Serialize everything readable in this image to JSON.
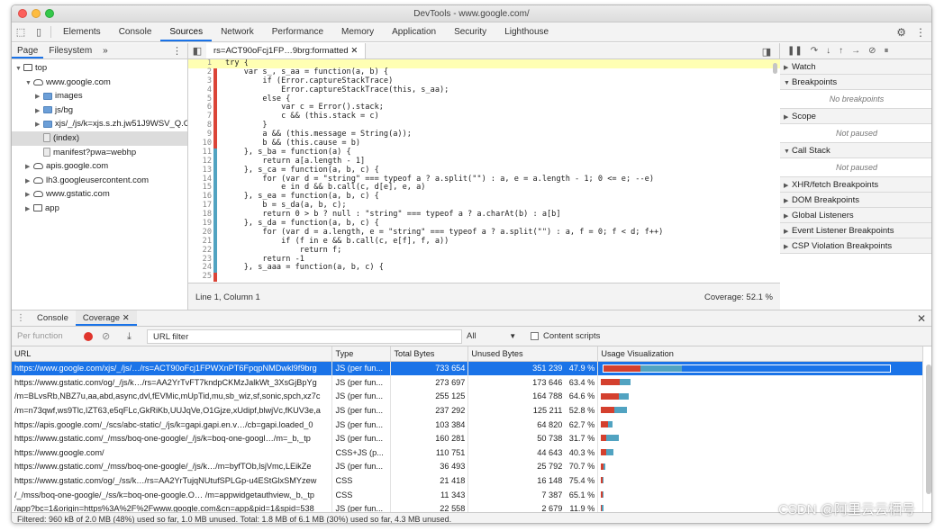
{
  "window": {
    "title": "DevTools - www.google.com/"
  },
  "main_tabs": [
    "Elements",
    "Console",
    "Sources",
    "Network",
    "Performance",
    "Memory",
    "Application",
    "Security",
    "Lighthouse"
  ],
  "main_tab_active": "Sources",
  "nav": {
    "tabs": [
      "Page",
      "Filesystem"
    ],
    "more": "»",
    "tree": [
      {
        "label": "top",
        "depth": 0,
        "arrow": "▼",
        "icon": "frame"
      },
      {
        "label": "www.google.com",
        "depth": 1,
        "arrow": "▼",
        "icon": "cloud"
      },
      {
        "label": "images",
        "depth": 2,
        "arrow": "▶",
        "icon": "folder"
      },
      {
        "label": "js/bg",
        "depth": 2,
        "arrow": "▶",
        "icon": "folder"
      },
      {
        "label": "xjs/_/js/k=xjs.s.zh.jw51J9WSV_Q.O",
        "depth": 2,
        "arrow": "▶",
        "icon": "folder"
      },
      {
        "label": "(index)",
        "depth": 2,
        "arrow": "",
        "icon": "file",
        "selected": true
      },
      {
        "label": "manifest?pwa=webhp",
        "depth": 2,
        "arrow": "",
        "icon": "file"
      },
      {
        "label": "apis.google.com",
        "depth": 1,
        "arrow": "▶",
        "icon": "cloud"
      },
      {
        "label": "lh3.googleusercontent.com",
        "depth": 1,
        "arrow": "▶",
        "icon": "cloud"
      },
      {
        "label": "www.gstatic.com",
        "depth": 1,
        "arrow": "▶",
        "icon": "cloud"
      },
      {
        "label": "app",
        "depth": 1,
        "arrow": "▶",
        "icon": "frame"
      }
    ]
  },
  "editor": {
    "tab_label": "rs=ACT90oFcj1FP…9brg:formatted",
    "tab_close": "✕",
    "lines": [
      {
        "n": "1",
        "cov": "none",
        "text": "try {",
        "hl": true
      },
      {
        "n": "2",
        "cov": "unused",
        "text": "    var s_, s_aa = function(a, b) {"
      },
      {
        "n": "3",
        "cov": "unused",
        "text": "        if (Error.captureStackTrace)"
      },
      {
        "n": "4",
        "cov": "unused",
        "text": "            Error.captureStackTrace(this, s_aa);"
      },
      {
        "n": "5",
        "cov": "unused",
        "text": "        else {"
      },
      {
        "n": "6",
        "cov": "unused",
        "text": "            var c = Error().stack;"
      },
      {
        "n": "7",
        "cov": "unused",
        "text": "            c && (this.stack = c)"
      },
      {
        "n": "8",
        "cov": "unused",
        "text": "        }"
      },
      {
        "n": "9",
        "cov": "unused",
        "text": "        a && (this.message = String(a));"
      },
      {
        "n": "10",
        "cov": "unused",
        "text": "        b && (this.cause = b)"
      },
      {
        "n": "11",
        "cov": "used",
        "text": "    }, s_ba = function(a) {"
      },
      {
        "n": "12",
        "cov": "used",
        "text": "        return a[a.length - 1]"
      },
      {
        "n": "13",
        "cov": "used",
        "text": "    }, s_ca = function(a, b, c) {"
      },
      {
        "n": "14",
        "cov": "used",
        "text": "        for (var d = \"string\" === typeof a ? a.split(\"\") : a, e = a.length - 1; 0 <= e; --e)"
      },
      {
        "n": "15",
        "cov": "used",
        "text": "            e in d && b.call(c, d[e], e, a)"
      },
      {
        "n": "16",
        "cov": "used",
        "text": "    }, s_ea = function(a, b, c) {"
      },
      {
        "n": "17",
        "cov": "used",
        "text": "        b = s_da(a, b, c);"
      },
      {
        "n": "18",
        "cov": "used",
        "text": "        return 0 > b ? null : \"string\" === typeof a ? a.charAt(b) : a[b]"
      },
      {
        "n": "19",
        "cov": "used",
        "text": "    }, s_da = function(a, b, c) {"
      },
      {
        "n": "20",
        "cov": "used",
        "text": "        for (var d = a.length, e = \"string\" === typeof a ? a.split(\"\") : a, f = 0; f < d; f++)"
      },
      {
        "n": "21",
        "cov": "used",
        "text": "            if (f in e && b.call(c, e[f], f, a))"
      },
      {
        "n": "22",
        "cov": "used",
        "text": "                return f;"
      },
      {
        "n": "23",
        "cov": "used",
        "text": "        return -1"
      },
      {
        "n": "24",
        "cov": "used",
        "text": "    }, s_aaa = function(a, b, c) {"
      },
      {
        "n": "25",
        "cov": "unused",
        "text": ""
      }
    ],
    "status_position": "Line 1, Column 1",
    "status_coverage": "Coverage: 52.1 %"
  },
  "debugger": {
    "sections": [
      {
        "label": "Watch",
        "tri": "▶"
      },
      {
        "label": "Breakpoints",
        "tri": "▼",
        "body": "No breakpoints"
      },
      {
        "label": "Scope",
        "tri": "▶",
        "body": "Not paused"
      },
      {
        "label": "Call Stack",
        "tri": "▼",
        "body": "Not paused"
      },
      {
        "label": "XHR/fetch Breakpoints",
        "tri": "▶"
      },
      {
        "label": "DOM Breakpoints",
        "tri": "▶"
      },
      {
        "label": "Global Listeners",
        "tri": "▶"
      },
      {
        "label": "Event Listener Breakpoints",
        "tri": "▶"
      },
      {
        "label": "CSP Violation Breakpoints",
        "tri": "▶"
      }
    ]
  },
  "drawer": {
    "tabs": [
      "Console",
      "Coverage"
    ],
    "active_tab": "Coverage",
    "tab_close": "✕",
    "toolbar": {
      "per_function": "Per function",
      "url_filter_placeholder": "URL filter",
      "type_select": "All",
      "content_scripts": "Content scripts"
    },
    "columns": [
      "URL",
      "Type",
      "Total Bytes",
      "Unused Bytes",
      "Usage Visualization"
    ],
    "rows": [
      {
        "url": "https://www.google.com/xjs/_/js/…/rs=ACT90oFcj1FPWXnPT6FpqpNMDwkl9f9brg",
        "type": "JS (per fun...",
        "total": "733 654",
        "unused": "351 239",
        "pct": "47.9 %",
        "total_val": 733654,
        "unused_val": 351239
      },
      {
        "url": "https://www.gstatic.com/og/_/js/k…/rs=AA2YrTvFT7kndpCKMzJalkWt_3XsGjBpYg",
        "type": "JS (per fun...",
        "total": "273 697",
        "unused": "173 646",
        "pct": "63.4 %",
        "total_val": 273697,
        "unused_val": 173646
      },
      {
        "url": "/m=BLvsRb,NBZ7u,aa,abd,async,dvl,fEVMic,mUpTid,mu,sb_wiz,sf,sonic,spch,xz7c",
        "type": "JS (per fun...",
        "total": "255 125",
        "unused": "164 788",
        "pct": "64.6 %",
        "total_val": 255125,
        "unused_val": 164788
      },
      {
        "url": "/m=n73qwf,ws9Tlc,IZT63,e5qFLc,GkRiKb,UUJqVe,O1Gjze,xUdipf,blwjVc,fKUV3e,a",
        "type": "JS (per fun...",
        "total": "237 292",
        "unused": "125 211",
        "pct": "52.8 %",
        "total_val": 237292,
        "unused_val": 125211
      },
      {
        "url": "https://apis.google.com/_/scs/abc-static/_/js/k=gapi.gapi.en.v…/cb=gapi.loaded_0",
        "type": "JS (per fun...",
        "total": "103 384",
        "unused": "64 820",
        "pct": "62.7 %",
        "total_val": 103384,
        "unused_val": 64820
      },
      {
        "url": "https://www.gstatic.com/_/mss/boq-one-google/_/js/k=boq-one-googl…/m=_b,_tp",
        "type": "JS (per fun...",
        "total": "160 281",
        "unused": "50 738",
        "pct": "31.7 %",
        "total_val": 160281,
        "unused_val": 50738
      },
      {
        "url": "https://www.google.com/",
        "type": "CSS+JS (p...",
        "total": "110 751",
        "unused": "44 643",
        "pct": "40.3 %",
        "total_val": 110751,
        "unused_val": 44643
      },
      {
        "url": "https://www.gstatic.com/_/mss/boq-one-google/_/js/k…/m=byfTOb,lsjVmc,LEikZe",
        "type": "JS (per fun...",
        "total": "36 493",
        "unused": "25 792",
        "pct": "70.7 %",
        "total_val": 36493,
        "unused_val": 25792
      },
      {
        "url": "https://www.gstatic.com/og/_/ss/k…/rs=AA2YrTujqNUtufSPLGp-u4EStGlxSMYzew",
        "type": "CSS",
        "total": "21 418",
        "unused": "16 148",
        "pct": "75.4 %",
        "total_val": 21418,
        "unused_val": 16148
      },
      {
        "url": "/_/mss/boq-one-google/_/ss/k=boq-one-google.O… /m=appwidgetauthview,_b,_tp",
        "type": "CSS",
        "total": "11 343",
        "unused": "7 387",
        "pct": "65.1 %",
        "total_val": 11343,
        "unused_val": 7387
      },
      {
        "url": "/app?bc=1&origin=https%3A%2F%2Fwww.google.com&cn=app&pid=1&spid=538",
        "type": "JS (per fun...",
        "total": "22 558",
        "unused": "2 679",
        "pct": "11.9 %",
        "total_val": 22558,
        "unused_val": 2679
      }
    ],
    "status": "Filtered: 960 kB of 2.0 MB (48%) used so far, 1.0 MB unused. Total: 1.8 MB of 6.1 MB (30%) used so far, 4.3 MB unused."
  },
  "watermark": "CSDN @阿里云云栖号",
  "colors": {
    "accent": "#1a73e8",
    "used": "#51a3c1",
    "unused": "#d4402e",
    "highlight": "#ffffb3"
  },
  "icons": [
    "inspect-icon",
    "device-icon",
    "gear-icon",
    "kebab-icon",
    "pause-icon",
    "step-over-icon",
    "step-into-icon",
    "step-out-icon",
    "step-icon",
    "deactivate-breakpoints-icon",
    "pause-exceptions-icon",
    "record-icon",
    "clear-icon",
    "download-icon",
    "close-icon"
  ]
}
